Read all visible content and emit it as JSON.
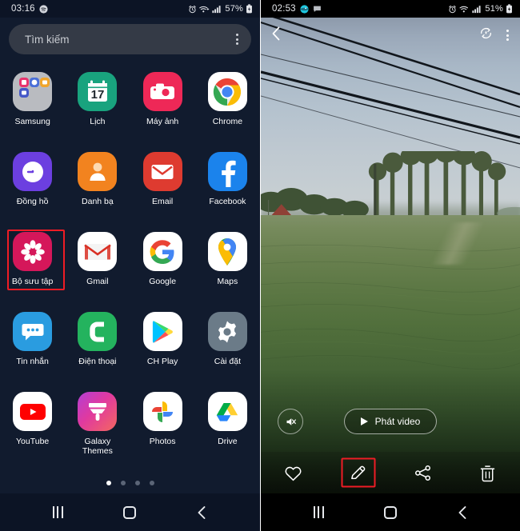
{
  "left_phone": {
    "status_bar": {
      "time": "03:16",
      "battery_percent": "57%",
      "icons": [
        "spotify-icon",
        "alarm-icon",
        "wifi-icon",
        "signal-icon",
        "battery-charging-icon"
      ]
    },
    "search": {
      "placeholder": "Tìm kiếm",
      "menu_icon": "kebab-menu-icon"
    },
    "apps": [
      {
        "label": "Samsung",
        "icon": "samsung-folder-icon"
      },
      {
        "label": "Lịch",
        "icon": "calendar-icon"
      },
      {
        "label": "Máy ảnh",
        "icon": "camera-icon"
      },
      {
        "label": "Chrome",
        "icon": "chrome-icon"
      },
      {
        "label": "Đồng hồ",
        "icon": "clock-icon"
      },
      {
        "label": "Danh bạ",
        "icon": "contacts-icon"
      },
      {
        "label": "Email",
        "icon": "email-icon"
      },
      {
        "label": "Facebook",
        "icon": "facebook-icon"
      },
      {
        "label": "Bộ sưu tập",
        "icon": "gallery-icon",
        "highlighted": true
      },
      {
        "label": "Gmail",
        "icon": "gmail-icon"
      },
      {
        "label": "Google",
        "icon": "google-icon"
      },
      {
        "label": "Maps",
        "icon": "maps-icon"
      },
      {
        "label": "Tin nhắn",
        "icon": "messages-icon"
      },
      {
        "label": "Điện thoại",
        "icon": "phone-icon"
      },
      {
        "label": "CH Play",
        "icon": "play-store-icon"
      },
      {
        "label": "Cài đặt",
        "icon": "settings-gear-icon"
      },
      {
        "label": "YouTube",
        "icon": "youtube-icon"
      },
      {
        "label": "Galaxy\nThemes",
        "icon": "galaxy-themes-icon"
      },
      {
        "label": "Photos",
        "icon": "google-photos-icon"
      },
      {
        "label": "Drive",
        "icon": "google-drive-icon"
      }
    ],
    "page_indicator": {
      "total": 4,
      "active_index": 0
    },
    "nav_bar": {
      "recent_icon": "recents-icon",
      "home_icon": "home-icon",
      "back_icon": "back-chevron-icon"
    }
  },
  "right_phone": {
    "status_bar": {
      "time": "02:53",
      "battery_percent": "51%",
      "icons": [
        "app-icon",
        "message-icon",
        "alarm-icon",
        "wifi-icon",
        "signal-icon",
        "battery-charging-icon"
      ]
    },
    "viewer_top": {
      "back_icon": "back-chevron-icon",
      "enhance_icon": "auto-enhance-icon",
      "menu_icon": "kebab-menu-icon"
    },
    "media": {
      "mute_icon": "mute-speaker-icon",
      "play_label": "Phát video",
      "play_icon": "play-triangle-icon"
    },
    "actions": [
      {
        "label": "favorite",
        "icon": "heart-icon"
      },
      {
        "label": "edit",
        "icon": "pencil-edit-icon",
        "highlighted": true
      },
      {
        "label": "share",
        "icon": "share-nodes-icon"
      },
      {
        "label": "delete",
        "icon": "trash-icon"
      }
    ],
    "nav_bar": {
      "recent_icon": "recents-icon",
      "home_icon": "home-icon",
      "back_icon": "back-chevron-icon"
    }
  },
  "colors": {
    "highlight": "#ee1c25",
    "home_bg": "#111b2e",
    "search_bg": "#343a46"
  }
}
